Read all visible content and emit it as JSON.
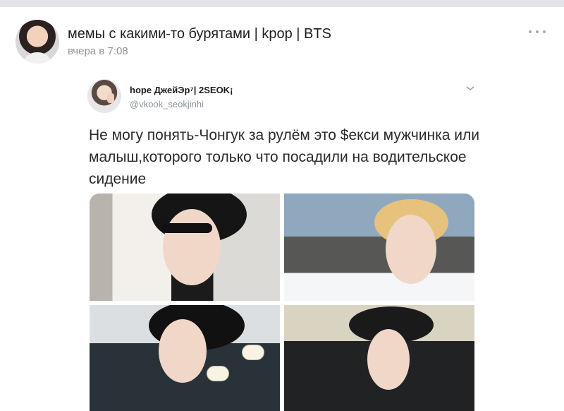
{
  "post": {
    "group_name": "мемы с какими-то бурятами | kpop | BTS",
    "time": "вчера в 7:08",
    "avatar_icon": "group-avatar",
    "menu_icon": "more-options-icon"
  },
  "tweet": {
    "author_name": "hope ДжейЭр⁷| 2SEOK¡",
    "author_handle": "@vkook_seokjinhi",
    "text": "Не могу понять-Чонгук за рулём это $екси мужчинка или малыш,которого только что посадили на водительское сидение",
    "images": [
      {
        "id": "photo-top-left"
      },
      {
        "id": "photo-top-right"
      },
      {
        "id": "photo-bottom-left"
      },
      {
        "id": "photo-bottom-right"
      }
    ]
  },
  "colors": {
    "top_bar": "#e3e4e8",
    "secondary_text": "#939393",
    "handle_text": "#8d949a"
  }
}
